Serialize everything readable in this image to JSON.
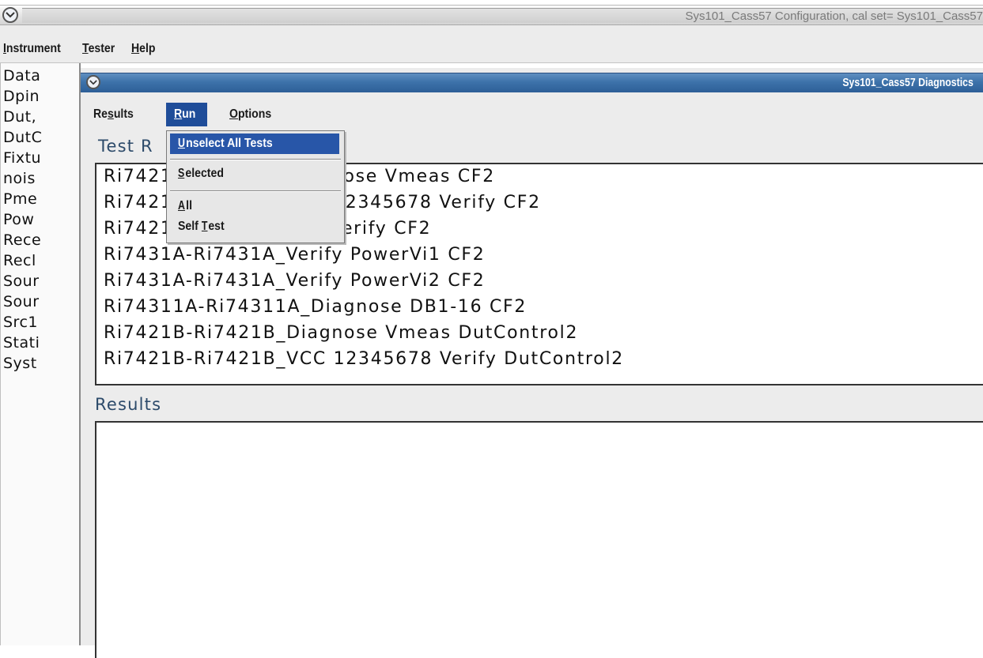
{
  "outer_window": {
    "title": "Sys101_Cass57 Configuration,  cal set= Sys101_Cass57",
    "menus": [
      "Instrument",
      "Tester",
      "Help"
    ]
  },
  "left_list": {
    "items": [
      "Data",
      "Dpin",
      "Dut,",
      "DutC",
      "Fixtu",
      "nois",
      "Pme",
      "Pow",
      "Rece",
      "Recl",
      "Sour",
      "Sour",
      "Src1",
      "Stati",
      "Syst"
    ]
  },
  "diagnostics_window": {
    "title": "Sys101_Cass57 Diagnostics",
    "menus": [
      "Results",
      "Run",
      "Options"
    ],
    "test_section_label": "Test R",
    "tests": [
      "Ri7421A-Ri7421A_Diagnose Vmeas CF2",
      "Ri7421A-Ri7421A_VCC 12345678 Verify CF2",
      "Ri7421A-Ri7421A_PVP Verify CF2",
      "Ri7431A-Ri7431A_Verify PowerVi1 CF2",
      "Ri7431A-Ri7431A_Verify PowerVi2 CF2",
      "Ri74311A-Ri74311A_Diagnose DB1-16 CF2",
      "Ri7421B-Ri7421B_Diagnose Vmeas DutControl2",
      "Ri7421B-Ri7421B_VCC 12345678 Verify DutControl2"
    ],
    "results_label": "Results"
  },
  "run_menu": {
    "items": [
      "Unselect All Tests",
      "Selected",
      "All",
      "Self Test"
    ],
    "highlighted": "Unselect All Tests"
  },
  "colors": {
    "title_active": "#3d72aa",
    "menu_highlight": "#2856a8",
    "section_label": "#2c4a6a"
  }
}
